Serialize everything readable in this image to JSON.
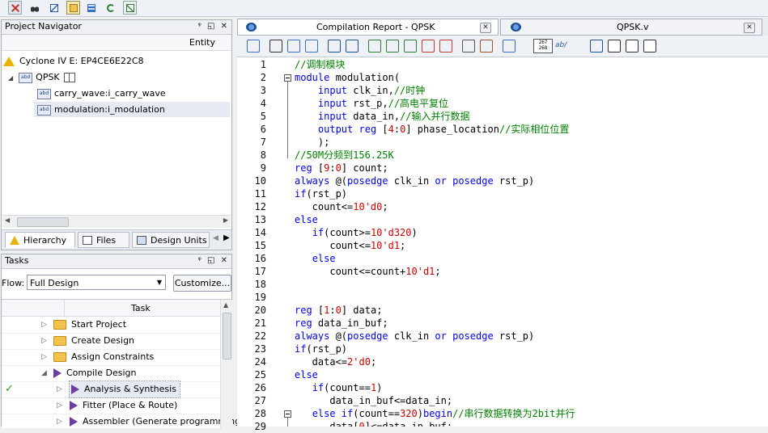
{
  "toolbar": {
    "icons": [
      "stop-icon",
      "binoculars-icon",
      "edit-icon",
      "project-icon",
      "grid-icon",
      "refresh-icon",
      "checklist-icon"
    ]
  },
  "project_navigator": {
    "title": "Project Navigator",
    "panel_buttons": "ᵠ ◱ ✕",
    "column_header": "Entity",
    "device": "Cyclone IV E: EP4CE6E22C8",
    "chip_text": "abd",
    "top_entity": "QPSK",
    "children": [
      "carry_wave:i_carry_wave",
      "modulation:i_modulation"
    ],
    "tabs": [
      "Hierarchy",
      "Files",
      "Design Units"
    ]
  },
  "tasks": {
    "title": "Tasks",
    "panel_buttons": "ᵠ ◱ ✕",
    "flow_label": "Flow:",
    "flow_value": "Full Design",
    "customize_button": "Customize...",
    "column_header": "Task",
    "items": [
      {
        "label": "Start Project",
        "kind": "folder"
      },
      {
        "label": "Create Design",
        "kind": "folder"
      },
      {
        "label": "Assign Constraints",
        "kind": "folder"
      },
      {
        "label": "Compile Design",
        "kind": "play"
      },
      {
        "label": "Analysis & Synthesis",
        "kind": "play"
      },
      {
        "label": "Fitter (Place & Route)",
        "kind": "play"
      },
      {
        "label": "Assembler (Generate programming",
        "kind": "play"
      }
    ]
  },
  "editor": {
    "tabs": [
      {
        "label": "Compilation Report - QPSK",
        "close": "✕"
      },
      {
        "label": "QPSK.v",
        "close": "✕"
      }
    ],
    "toolbar_buttons": [
      "save-icon",
      "find-icon",
      "replace-icon",
      "goto-icon",
      "indent-icon",
      "unindent-icon",
      "bookmark-icon",
      "next-bookmark-icon",
      "prev-bookmark-icon",
      "clear-bookmark-icon",
      "clear-all-bookmark-icon",
      "insert-template-icon",
      "toggle-comment-icon",
      "block-icon",
      "line-number-icon",
      "spell-icon",
      "arrow-icon",
      "list-icon",
      "list2-icon",
      "list3-icon"
    ],
    "line_number_button": "267\n268",
    "spell_button": "ab/",
    "lines": [
      {
        "n": "1",
        "segs": [
          [
            "cm",
            "//调制模块"
          ]
        ]
      },
      {
        "n": "2",
        "segs": [
          [
            "kw",
            "module"
          ],
          [
            "",
            " modulation("
          ]
        ]
      },
      {
        "n": "3",
        "segs": [
          [
            "",
            "    "
          ],
          [
            "kw",
            "input"
          ],
          [
            "",
            " clk_in,"
          ],
          [
            "cm",
            "//时钟"
          ]
        ]
      },
      {
        "n": "4",
        "segs": [
          [
            "",
            "    "
          ],
          [
            "kw",
            "input"
          ],
          [
            "",
            " rst_p,"
          ],
          [
            "cm",
            "//高电平复位"
          ]
        ]
      },
      {
        "n": "5",
        "segs": [
          [
            "",
            "    "
          ],
          [
            "kw",
            "input"
          ],
          [
            "",
            " data_in,"
          ],
          [
            "cm",
            "//输入并行数据"
          ]
        ]
      },
      {
        "n": "6",
        "segs": [
          [
            "",
            "    "
          ],
          [
            "kw",
            "output"
          ],
          [
            "",
            " "
          ],
          [
            "kw",
            "reg"
          ],
          [
            "",
            " ["
          ],
          [
            "nm",
            "4"
          ],
          [
            "",
            ":"
          ],
          [
            "nm",
            "0"
          ],
          [
            "",
            "] phase_location"
          ],
          [
            "cm",
            "//实际相位位置"
          ]
        ]
      },
      {
        "n": "7",
        "segs": [
          [
            "",
            "    );"
          ]
        ]
      },
      {
        "n": "8",
        "segs": [
          [
            "cm",
            "//50M分频到156.25K"
          ]
        ]
      },
      {
        "n": "9",
        "segs": [
          [
            "kw",
            "reg"
          ],
          [
            "",
            " ["
          ],
          [
            "nm",
            "9"
          ],
          [
            "",
            ":"
          ],
          [
            "nm",
            "0"
          ],
          [
            "",
            "] count;"
          ]
        ]
      },
      {
        "n": "10",
        "segs": [
          [
            "kw",
            "always"
          ],
          [
            "",
            " @("
          ],
          [
            "kw",
            "posedge"
          ],
          [
            "",
            " clk_in "
          ],
          [
            "kw",
            "or"
          ],
          [
            "",
            " "
          ],
          [
            "kw",
            "posedge"
          ],
          [
            "",
            " rst_p)"
          ]
        ]
      },
      {
        "n": "11",
        "segs": [
          [
            "kw",
            "if"
          ],
          [
            "",
            "(rst_p)"
          ]
        ]
      },
      {
        "n": "12",
        "segs": [
          [
            "",
            "   count<="
          ],
          [
            "nm",
            "10'd0"
          ],
          [
            "",
            ";"
          ]
        ]
      },
      {
        "n": "13",
        "segs": [
          [
            "kw",
            "else"
          ]
        ]
      },
      {
        "n": "14",
        "segs": [
          [
            "",
            "   "
          ],
          [
            "kw",
            "if"
          ],
          [
            "",
            "(count>="
          ],
          [
            "nm",
            "10'd320"
          ],
          [
            "",
            ")"
          ]
        ]
      },
      {
        "n": "15",
        "segs": [
          [
            "",
            "      count<="
          ],
          [
            "nm",
            "10'd1"
          ],
          [
            "",
            ";"
          ]
        ]
      },
      {
        "n": "16",
        "segs": [
          [
            "",
            "   "
          ],
          [
            "kw",
            "else"
          ]
        ]
      },
      {
        "n": "17",
        "segs": [
          [
            "",
            "      count<=count+"
          ],
          [
            "nm",
            "10'd1"
          ],
          [
            "",
            ";"
          ]
        ]
      },
      {
        "n": "18",
        "segs": []
      },
      {
        "n": "19",
        "segs": []
      },
      {
        "n": "20",
        "segs": [
          [
            "kw",
            "reg"
          ],
          [
            "",
            " ["
          ],
          [
            "nm",
            "1"
          ],
          [
            "",
            ":"
          ],
          [
            "nm",
            "0"
          ],
          [
            "",
            "] data;"
          ]
        ]
      },
      {
        "n": "21",
        "segs": [
          [
            "kw",
            "reg"
          ],
          [
            "",
            " data_in_buf;"
          ]
        ]
      },
      {
        "n": "22",
        "segs": [
          [
            "kw",
            "always"
          ],
          [
            "",
            " @("
          ],
          [
            "kw",
            "posedge"
          ],
          [
            "",
            " clk_in "
          ],
          [
            "kw",
            "or"
          ],
          [
            "",
            " "
          ],
          [
            "kw",
            "posedge"
          ],
          [
            "",
            " rst_p)"
          ]
        ]
      },
      {
        "n": "23",
        "segs": [
          [
            "kw",
            "if"
          ],
          [
            "",
            "(rst_p)"
          ]
        ]
      },
      {
        "n": "24",
        "segs": [
          [
            "",
            "   data<="
          ],
          [
            "nm",
            "2'd0"
          ],
          [
            "",
            ";"
          ]
        ]
      },
      {
        "n": "25",
        "segs": [
          [
            "kw",
            "else"
          ]
        ]
      },
      {
        "n": "26",
        "segs": [
          [
            "",
            "   "
          ],
          [
            "kw",
            "if"
          ],
          [
            "",
            "(count=="
          ],
          [
            "nm",
            "1"
          ],
          [
            "",
            ")"
          ]
        ]
      },
      {
        "n": "27",
        "segs": [
          [
            "",
            "      data_in_buf<=data_in;"
          ]
        ]
      },
      {
        "n": "28",
        "segs": [
          [
            "",
            "   "
          ],
          [
            "kw",
            "else if"
          ],
          [
            "",
            "(count=="
          ],
          [
            "nm",
            "320"
          ],
          [
            "",
            ")"
          ],
          [
            "kw",
            "begin"
          ],
          [
            "cm",
            "//串行数据转换为2bit并行"
          ]
        ]
      },
      {
        "n": "29",
        "segs": [
          [
            "",
            "      data["
          ],
          [
            "nm",
            "0"
          ],
          [
            "",
            "]<=data_in_buf;"
          ]
        ]
      }
    ]
  }
}
